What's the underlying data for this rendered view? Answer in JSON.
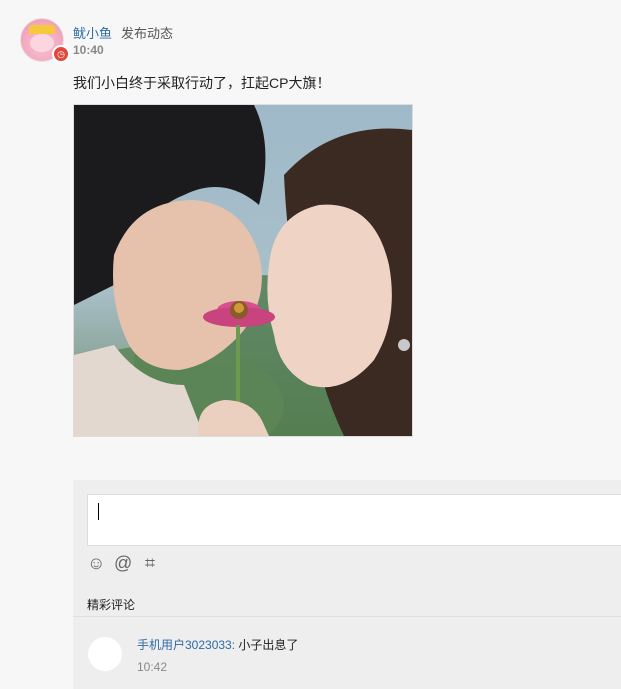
{
  "post": {
    "username": "鱿小鱼",
    "action": "发布动态",
    "time": "10:40",
    "text": "我们小白终于采取行动了，扛起CP大旗！",
    "badge_icon": "timer-badge-icon"
  },
  "composer": {
    "placeholder": "",
    "tools": [
      {
        "icon": "emoji-icon",
        "glyph": "☺"
      },
      {
        "icon": "mention-icon",
        "glyph": "@"
      },
      {
        "icon": "hashtag-icon",
        "glyph": "⌗"
      }
    ]
  },
  "comments": {
    "section_title": "精彩评论",
    "items": [
      {
        "user": "手机用户3023033:",
        "text": "小子出息了",
        "time": "10:42"
      }
    ]
  }
}
